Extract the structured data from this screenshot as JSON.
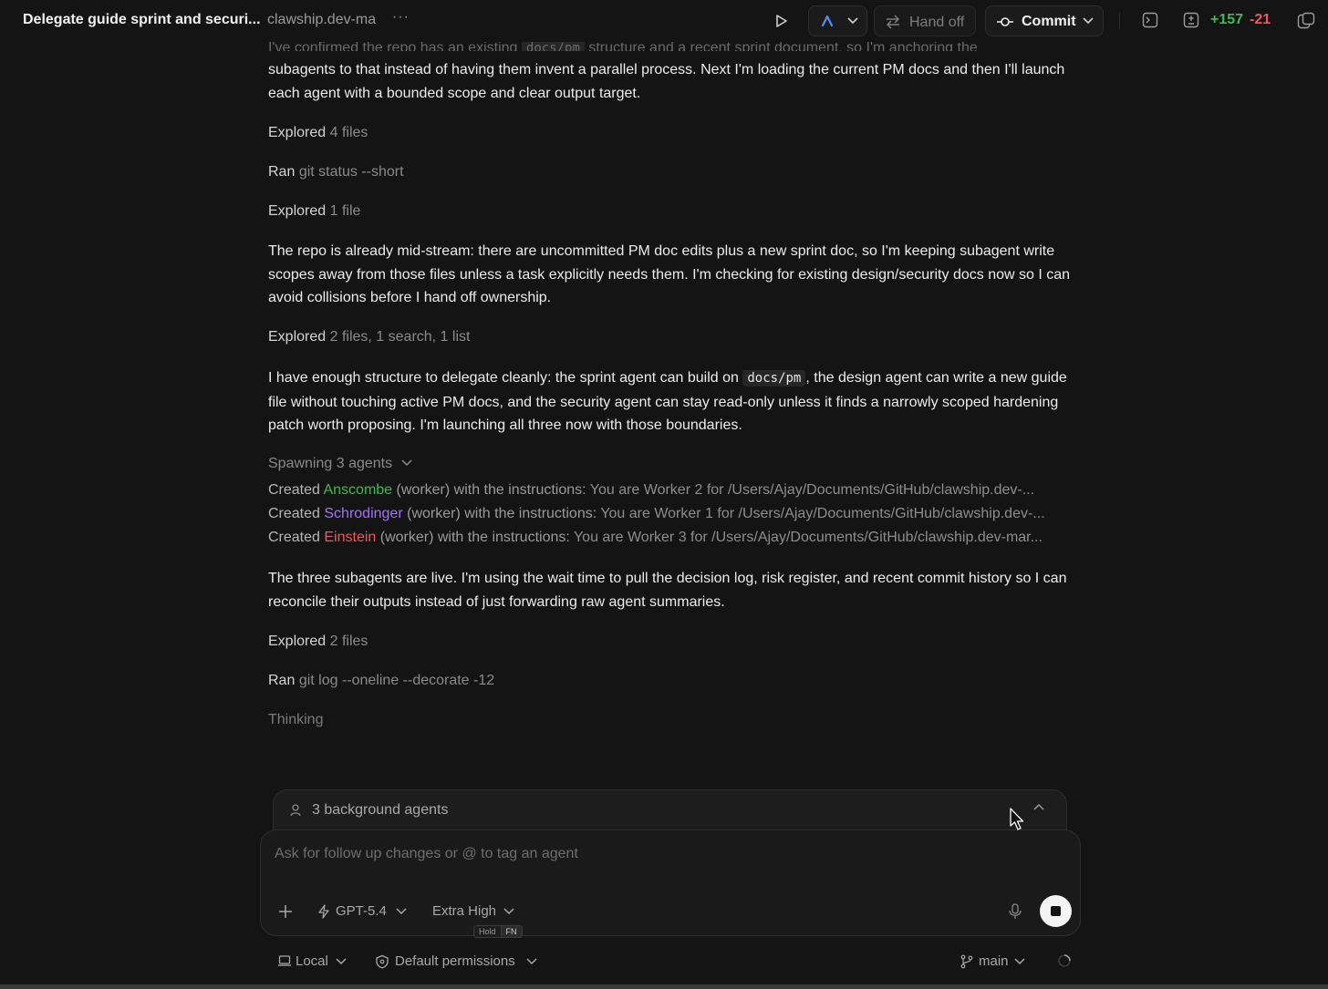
{
  "header": {
    "title": "Delegate guide sprint and securi...",
    "repo": "clawship.dev-ma",
    "hand_off_label": "Hand off",
    "commit_label": "Commit",
    "additions": "+157",
    "deletions": "-21"
  },
  "chat": {
    "intro_faded": "I've confirmed the repo has an existing",
    "intro_code": "docs/pm",
    "intro_faded_tail": "structure and a recent sprint document, so I'm anchoring the",
    "intro_rest": "subagents to that instead of having them invent a parallel process. Next I'm loading the current PM docs and then I'll launch each agent with a bounded scope and clear output target.",
    "tool1": {
      "verb": "Explored",
      "detail": "4 files"
    },
    "tool2": {
      "verb": "Ran",
      "detail": "git status --short"
    },
    "tool3": {
      "verb": "Explored",
      "detail": "1 file"
    },
    "msg2": "The repo is already mid-stream: there are uncommitted PM doc edits plus a new sprint doc, so I'm keeping subagent write scopes away from those files unless a task explicitly needs them. I'm checking for existing design/security docs now so I can avoid collisions before I hand off ownership.",
    "tool4": {
      "verb": "Explored",
      "detail": "2 files, 1 search, 1 list"
    },
    "msg3_a": "I have enough structure to delegate cleanly: the sprint agent can build on",
    "msg3_code": "docs/pm",
    "msg3_b": ", the design agent can write a new guide file without touching active PM docs, and the security agent can stay read-only unless it finds a narrowly scoped hardening patch worth proposing. I'm launching all three now with those boundaries.",
    "spawning_label": "Spawning 3 agents",
    "created_prefix": "Created",
    "role": "(worker) with the instructions:",
    "agents": [
      {
        "name": "Anscombe",
        "color": "#3fb950",
        "instructions": "You are Worker 2 for /Users/Ajay/Documents/GitHub/clawship.dev-..."
      },
      {
        "name": "Schrodinger",
        "color": "#a371f7",
        "instructions": "You are Worker 1 for /Users/Ajay/Documents/GitHub/clawship.dev-..."
      },
      {
        "name": "Einstein",
        "color": "#f2555a",
        "instructions": "You are Worker 3 for /Users/Ajay/Documents/GitHub/clawship.dev-mar..."
      }
    ],
    "msg4": "The three subagents are live. I'm using the wait time to pull the decision log, risk register, and recent commit history so I can reconcile their outputs instead of just forwarding raw agent summaries.",
    "tool5": {
      "verb": "Explored",
      "detail": "2 files"
    },
    "tool6": {
      "verb": "Ran",
      "detail": "git log --oneline --decorate -12"
    },
    "thinking": "Thinking"
  },
  "composer": {
    "background_agents": "3 background agents",
    "placeholder": "Ask for follow up changes or @ to tag an agent",
    "model": "GPT-5.4",
    "effort": "Extra High",
    "hint_hold": "Hold",
    "hint_key": "FN"
  },
  "footer": {
    "environment": "Local",
    "permissions": "Default permissions",
    "branch": "main"
  }
}
